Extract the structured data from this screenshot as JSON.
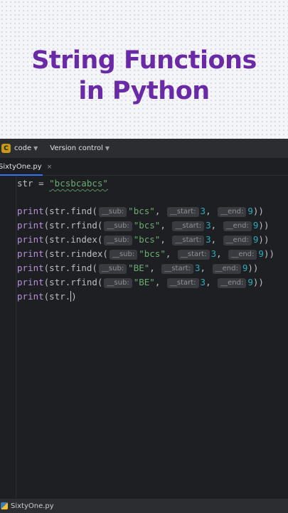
{
  "banner": {
    "title_line1": "String Functions",
    "title_line2": "in Python"
  },
  "toolbar": {
    "project_badge": "C",
    "project_name": "code",
    "vcs_label": "Version control"
  },
  "tab": {
    "filename": "SixtyOne.py",
    "close": "×"
  },
  "code": {
    "line1": {
      "var": "str",
      "op": " = ",
      "value": "\"bcsbcabcs\""
    },
    "lines": [
      {
        "print": "print",
        "call": "(str.find(",
        "hint_sub": "__sub:",
        "arg_sub": "\"bcs\"",
        "hint_start": "__start:",
        "arg_start": "3",
        "hint_end": "__end:",
        "arg_end": "9",
        "close": "))"
      },
      {
        "print": "print",
        "call": "(str.rfind(",
        "hint_sub": "__sub:",
        "arg_sub": "\"bcs\"",
        "hint_start": "__start:",
        "arg_start": "3",
        "hint_end": "__end:",
        "arg_end": "9",
        "close": "))"
      },
      {
        "print": "print",
        "call": "(str.index(",
        "hint_sub": "__sub:",
        "arg_sub": "\"bcs\"",
        "hint_start": "__start:",
        "arg_start": "3",
        "hint_end": "__end:",
        "arg_end": "9",
        "close": "))"
      },
      {
        "print": "print",
        "call": "(str.rindex(",
        "hint_sub": "__sub:",
        "arg_sub": "\"bcs\"",
        "hint_start": "__start:",
        "arg_start": "3",
        "hint_end": "__end:",
        "arg_end": "9",
        "close": "))"
      },
      {
        "print": "print",
        "call": "(str.find(",
        "hint_sub": "__sub:",
        "arg_sub": "\"BE\"",
        "hint_start": "__start:",
        "arg_start": "3",
        "hint_end": "__end:",
        "arg_end": "9",
        "close": "))"
      },
      {
        "print": "print",
        "call": "(str.rfind(",
        "hint_sub": "__sub:",
        "arg_sub": "\"BE\"",
        "hint_start": "__start:",
        "arg_start": "3",
        "hint_end": "__end:",
        "arg_end": "9",
        "close": "))"
      }
    ],
    "last_line": {
      "print": "print",
      "partial": "(str.",
      "close": ")"
    }
  },
  "status": {
    "filename": "SixtyOne.py"
  },
  "colors": {
    "accent": "#3574f0",
    "title": "#6a2aa6",
    "keyword": "#b591d6",
    "string": "#6aab73",
    "number": "#2aacb8"
  }
}
